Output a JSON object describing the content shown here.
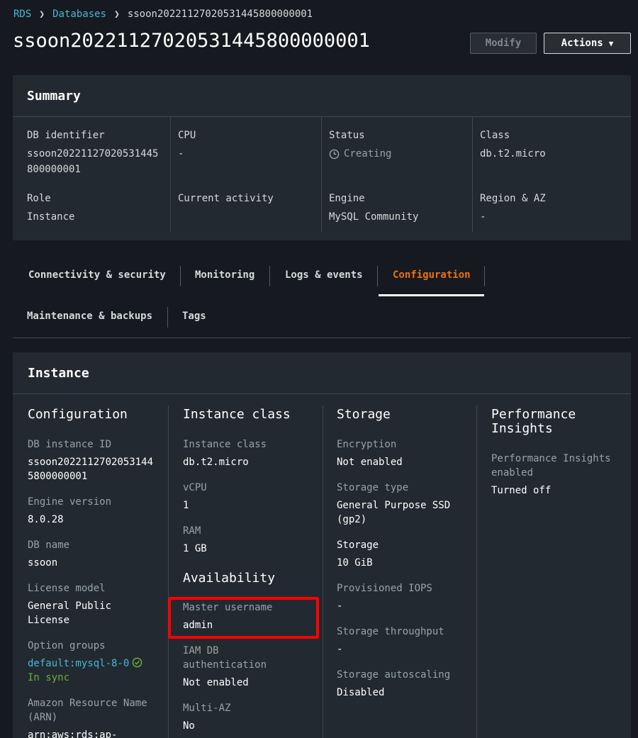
{
  "breadcrumb": {
    "rds": "RDS",
    "databases": "Databases",
    "current": "ssoon20221127020531445800000001"
  },
  "page_title": "ssoon20221127020531445800000001",
  "buttons": {
    "modify": "Modify",
    "actions": "Actions"
  },
  "summary": {
    "title": "Summary",
    "db_identifier_label": "DB identifier",
    "db_identifier_line1": "ssoon20221127020531445",
    "db_identifier_line2": "800000001",
    "cpu_label": "CPU",
    "cpu_value": "-",
    "status_label": "Status",
    "status_value": "Creating",
    "class_label": "Class",
    "class_value": "db.t2.micro",
    "role_label": "Role",
    "role_value": "Instance",
    "activity_label": "Current activity",
    "engine_label": "Engine",
    "engine_value": "MySQL Community",
    "region_label": "Region & AZ",
    "region_value": "-"
  },
  "tabs": {
    "connectivity": "Connectivity & security",
    "monitoring": "Monitoring",
    "logs": "Logs & events",
    "configuration": "Configuration",
    "maintenance": "Maintenance & backups",
    "tags": "Tags"
  },
  "instance": {
    "title": "Instance",
    "configuration": {
      "heading": "Configuration",
      "db_instance_id_label": "DB instance ID",
      "db_instance_id_line1": "ssoon2022112702053144",
      "db_instance_id_line2": "5800000001",
      "engine_version_label": "Engine version",
      "engine_version_value": "8.0.28",
      "db_name_label": "DB name",
      "db_name_value": "ssoon",
      "license_label": "License model",
      "license_line1": "General Public",
      "license_line2": "License",
      "option_groups_label": "Option groups",
      "option_groups_link": "default:mysql-8-0",
      "option_groups_status": "In sync",
      "arn_label_line1": "Amazon Resource Name",
      "arn_label_line2": "(ARN)",
      "arn_value": "arn:aws:rds:ap-"
    },
    "instance_class": {
      "heading": "Instance class",
      "class_label": "Instance class",
      "class_value": "db.t2.micro",
      "vcpu_label": "vCPU",
      "vcpu_value": "1",
      "ram_label": "RAM",
      "ram_value": "1 GB",
      "availability_heading": "Availability",
      "master_username_label": "Master username",
      "master_username_value": "admin",
      "iam_label_line1": "IAM DB",
      "iam_label_line2": "authentication",
      "iam_value": "Not enabled",
      "multi_az_label": "Multi-AZ",
      "multi_az_value": "No"
    },
    "storage": {
      "heading": "Storage",
      "encryption_label": "Encryption",
      "encryption_value": "Not enabled",
      "storage_type_label": "Storage type",
      "storage_type_line1": "General Purpose SSD",
      "storage_type_line2": "(gp2)",
      "storage_label": "Storage",
      "storage_value": "10 GiB",
      "iops_label": "Provisioned IOPS",
      "iops_value": "-",
      "throughput_label": "Storage throughput",
      "throughput_value": "-",
      "autoscaling_label": "Storage autoscaling",
      "autoscaling_value": "Disabled"
    },
    "performance": {
      "heading_line1": "Performance",
      "heading_line2": "Insights",
      "enabled_label_line1": "Performance Insights",
      "enabled_label_line2": "enabled",
      "enabled_value": "Turned off"
    }
  },
  "colors": {
    "background": "#16191f",
    "panel": "#232930",
    "link": "#44b9d6",
    "active_tab": "#ec7211",
    "success": "#6aaf35",
    "highlight": "#ff0000"
  }
}
